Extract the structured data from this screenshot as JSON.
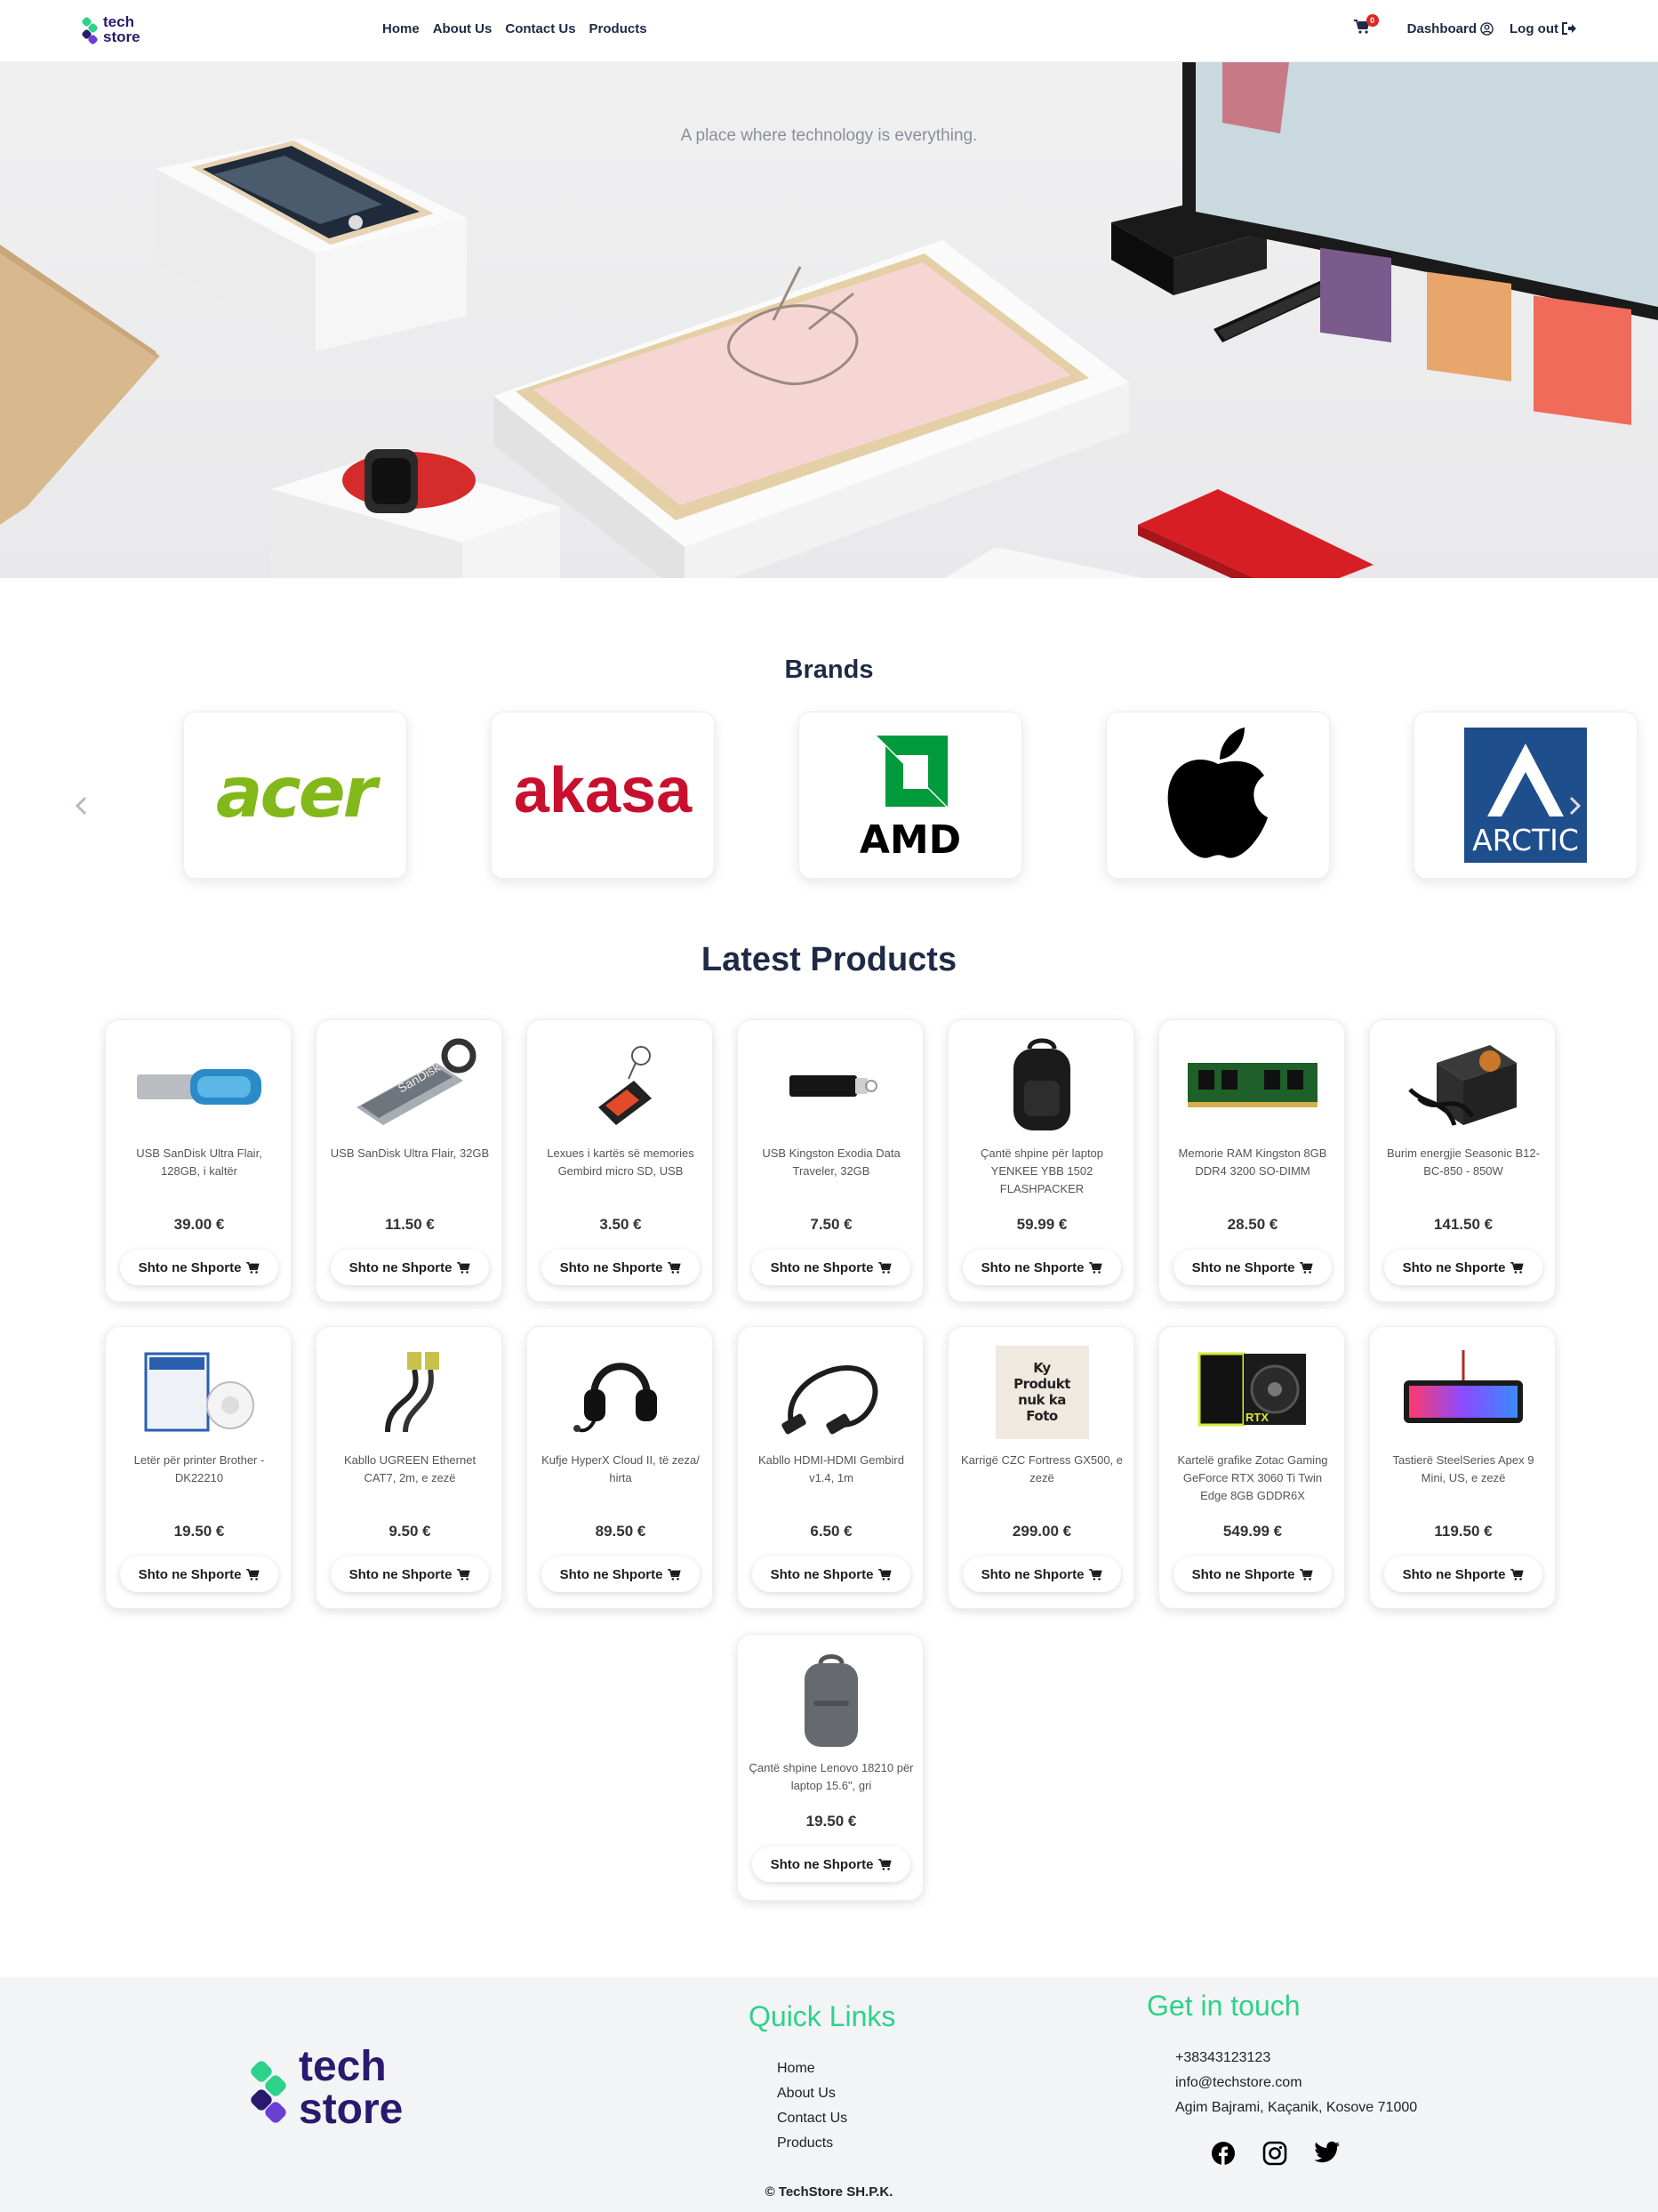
{
  "nav": {
    "logo_line1": "tech",
    "logo_line2": "store",
    "links": [
      "Home",
      "About Us",
      "Contact Us",
      "Products"
    ],
    "cart_count": "0",
    "dashboard": "Dashboard",
    "logout": "Log out"
  },
  "hero": {
    "tagline": "A place where technology is everything."
  },
  "brands": {
    "title": "Brands",
    "items": [
      "acer",
      "akasa",
      "AMD",
      "apple",
      "ARCTIC"
    ]
  },
  "latest": {
    "title": "Latest Products",
    "add_label": "Shto ne Shporte",
    "products": [
      {
        "name": "USB SanDisk Ultra Flair, 128GB, i kaltër",
        "price": "39.00 €",
        "icon": "usb-flash-blue"
      },
      {
        "name": "USB SanDisk Ultra Flair, 32GB",
        "price": "11.50 €",
        "icon": "usb-flash-silver"
      },
      {
        "name": "Lexues i kartës së memories Gembird micro SD, USB",
        "price": "3.50 €",
        "icon": "card-reader"
      },
      {
        "name": "USB Kingston Exodia Data Traveler, 32GB",
        "price": "7.50 €",
        "icon": "usb-flash-black"
      },
      {
        "name": "Çantë shpine për laptop YENKEE YBB 1502 FLASHPACKER",
        "price": "59.99 €",
        "icon": "backpack-black"
      },
      {
        "name": "Memorie RAM Kingston 8GB DDR4 3200 SO-DIMM",
        "price": "28.50 €",
        "icon": "ram-module"
      },
      {
        "name": "Burim energjie Seasonic B12-BC-850 - 850W",
        "price": "141.50 €",
        "icon": "power-supply"
      },
      {
        "name": "Letër për printer Brother - DK22210",
        "price": "19.50 €",
        "icon": "label-tape"
      },
      {
        "name": "Kabllo UGREEN Ethernet CAT7, 2m, e zezë",
        "price": "9.50 €",
        "icon": "ethernet-cable"
      },
      {
        "name": "Kufje HyperX Cloud II, të zeza/ hirta",
        "price": "89.50 €",
        "icon": "headset"
      },
      {
        "name": "Kabllo HDMI-HDMI Gembird v1.4, 1m",
        "price": "6.50 €",
        "icon": "hdmi-cable"
      },
      {
        "name": "Karrigë CZC Fortress GX500, e zezë",
        "price": "299.00 €",
        "icon": "no-photo",
        "placeholder": "Ky Produkt nuk ka Foto"
      },
      {
        "name": "Kartelë grafike Zotac Gaming GeForce RTX 3060 Ti Twin Edge 8GB GDDR6X",
        "price": "549.99 €",
        "icon": "graphics-card"
      },
      {
        "name": "Tastierë SteelSeries Apex 9 Mini, US, e zezë",
        "price": "119.50 €",
        "icon": "keyboard"
      },
      {
        "name": "Çantë shpine Lenovo 18210 për laptop 15.6\", gri",
        "price": "19.50 €",
        "icon": "backpack-gray"
      }
    ]
  },
  "footer": {
    "logo_line1": "tech",
    "logo_line2": "store",
    "quick_links_title": "Quick Links",
    "quick_links": [
      "Home",
      "About Us",
      "Contact Us",
      "Products"
    ],
    "contact_title": "Get in touch",
    "phone": "+38343123123",
    "email": "info@techstore.com",
    "address": "Agim Bajrami, Kaçanik, Kosove 71000",
    "social": [
      "facebook-icon",
      "instagram-icon",
      "twitter-icon"
    ],
    "copyright": "© TechStore SH.P.K."
  },
  "colors": {
    "brand_purple": "#2a1a6e",
    "brand_green": "#2ed18a",
    "text_dark": "#1f2a44",
    "badge_red": "#e02424",
    "acer_green": "#83b81a",
    "akasa_red": "#c8102e",
    "arctic_blue": "#1f4e8c"
  }
}
